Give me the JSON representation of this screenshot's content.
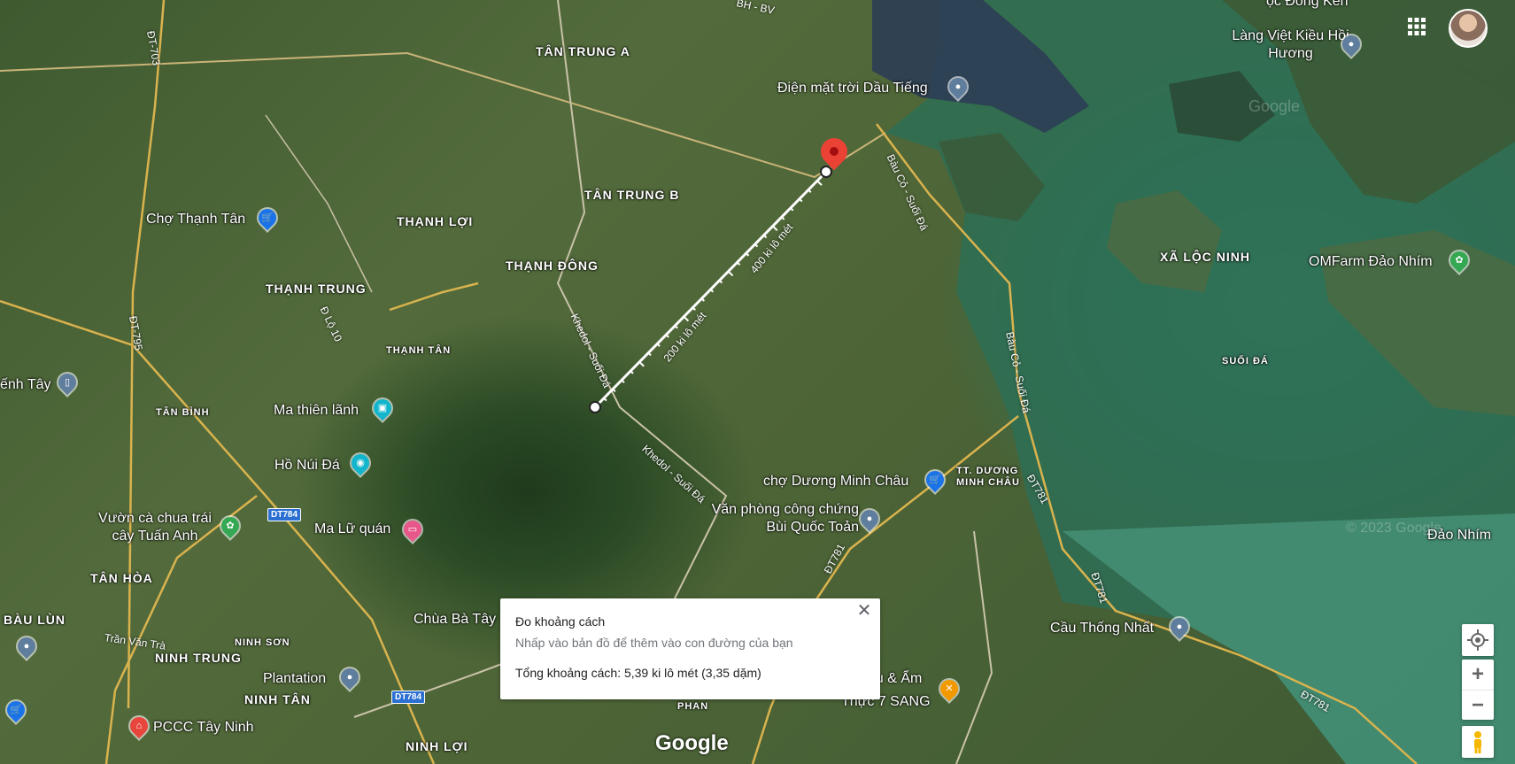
{
  "areas": [
    {
      "text": "TÂN TRUNG A"
    },
    {
      "text": "TÂN TRUNG B"
    },
    {
      "text": "THẠNH LỢI"
    },
    {
      "text": "THẠNH ĐÔNG"
    },
    {
      "text": "THẠNH TRUNG"
    },
    {
      "text": "THẠNH TÂN"
    },
    {
      "text": "TÂN BÌNH"
    },
    {
      "text": "TÂN HÒA"
    },
    {
      "text": "BÀU LÙN"
    },
    {
      "text": "NINH SƠN"
    },
    {
      "text": "NINH TRUNG"
    },
    {
      "text": "NINH TÂN"
    },
    {
      "text": "NINH LỢI"
    },
    {
      "text": "XÃ LỘC NINH"
    },
    {
      "text": "SUỐI ĐÁ"
    },
    {
      "text": "TT. DƯƠNG MINH CHÂU"
    },
    {
      "text": "PHAN"
    }
  ],
  "pois": [
    {
      "text": "Điện mặt trời Dầu Tiếng",
      "icon": "place-pin-icon",
      "color": "#5f7d9c"
    },
    {
      "text": "Chợ Thạnh Tân",
      "icon": "shopping-cart-icon",
      "color": "#1a73e8"
    },
    {
      "text": "Ma thiên lãnh",
      "icon": "museum-icon",
      "color": "#12b5cb"
    },
    {
      "text": "Hồ Núi Đá",
      "icon": "camera-icon",
      "color": "#12b5cb"
    },
    {
      "text": "Vườn cà chua trái cây Tuấn Anh",
      "icon": "park-icon",
      "color": "#34a853"
    },
    {
      "text": "Ma Lữ quán",
      "icon": "hotel-icon",
      "color": "#e8578a"
    },
    {
      "text": "Chùa Bà Tây",
      "icon": "",
      "color": ""
    },
    {
      "text": "Plantation",
      "icon": "place-pin-icon",
      "color": "#5f7d9c"
    },
    {
      "text": "PCCC Tây Ninh",
      "icon": "government-icon",
      "color": "#e8453c"
    },
    {
      "text": "chợ Dương Minh Châu",
      "icon": "shopping-cart-icon",
      "color": "#1a73e8"
    },
    {
      "text": "Văn phòng công chứng Bùi Quốc Toản",
      "icon": "place-pin-icon",
      "color": "#5f7d9c"
    },
    {
      "text": "Cầu Thống Nhất",
      "icon": "place-pin-icon",
      "color": "#5f7d9c"
    },
    {
      "text": "Làng Việt Kiều Hồi Hương",
      "icon": "place-pin-icon",
      "color": "#5f7d9c"
    },
    {
      "text": "OMFarm Đảo Nhím",
      "icon": "park-icon",
      "color": "#34a853"
    },
    {
      "text": "Đảo Nhím",
      "icon": "",
      "color": ""
    },
    {
      "text": "Thực 7 SANG",
      "icon": "restaurant-icon",
      "color": "#f29900"
    },
    {
      "text": "ếnh Tây",
      "icon": "bus-icon",
      "color": "#5f7d9c"
    },
    {
      "text": "ọc Đông Ken",
      "icon": "",
      "color": ""
    },
    {
      "text": "ầu & Ẩm",
      "icon": "",
      "color": ""
    }
  ],
  "roads": {
    "dt781": "ĐT781",
    "dt784": "DT784",
    "dt703": "ĐT-703",
    "dt795": "ĐT-795",
    "khedol": "Khedol - Suối Đá",
    "bauco": "Bàu Cỏ - Suối Đá",
    "tranvantra": "Trần Văn Trà",
    "loi10": "Đ Lộ 10",
    "bh": "BH - BV"
  },
  "measurement": {
    "tick_200": "200 ki lô mét",
    "tick_400": "400 ki lô mét",
    "line_color": "#ffffff",
    "pin_color": "#ea4335"
  },
  "info_panel": {
    "title": "Đo khoảng cách",
    "subtitle": "Nhấp vào bản đồ để thêm vào con đường của bạn",
    "total": "Tổng khoảng cách: 5,39 ki lô mét (3,35 dặm)",
    "close_icon": "close-icon"
  },
  "controls": {
    "zoom_in": "+",
    "zoom_out": "−",
    "location_icon": "my-location-icon",
    "pegman_icon": "pegman-icon",
    "apps_icon": "apps-grid-icon",
    "avatar_icon": "user-avatar-icon"
  },
  "branding": {
    "logo": "Google",
    "watermark": "Google",
    "copyright": "© 2023 Google"
  }
}
